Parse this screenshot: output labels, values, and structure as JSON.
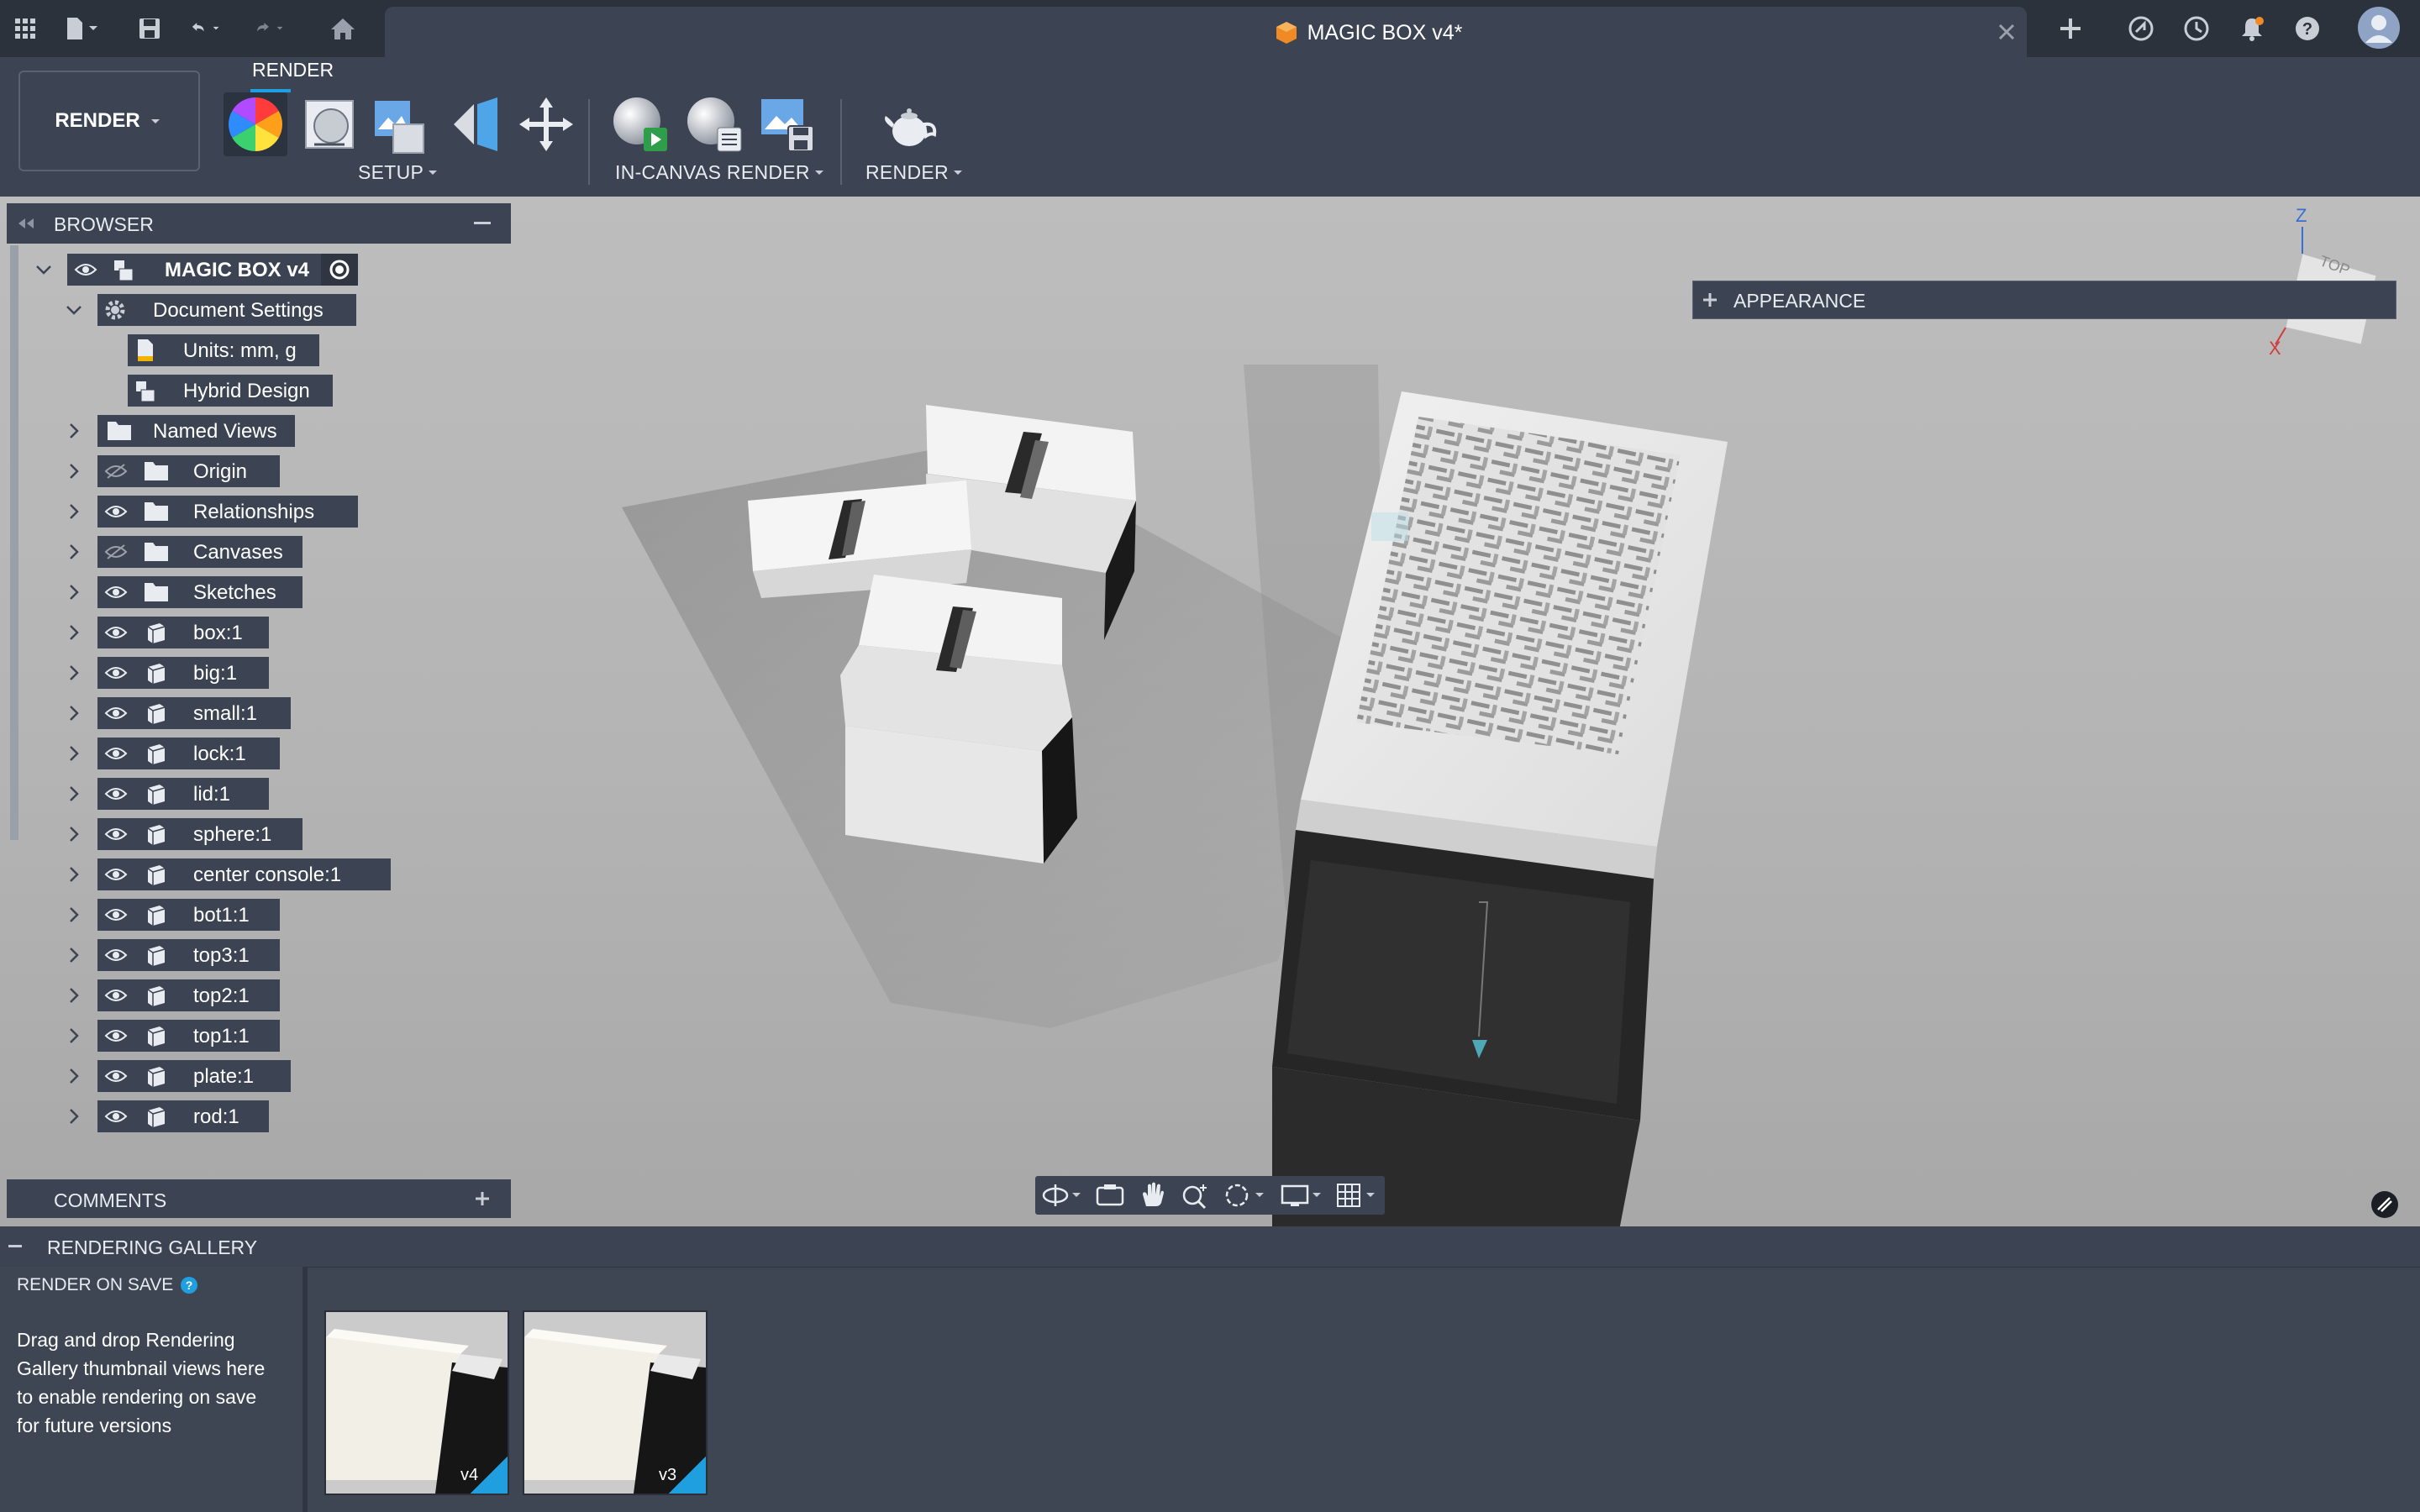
{
  "titlebar": {
    "document_title": "MAGIC BOX v4*",
    "icons": [
      "apps-grid-icon",
      "file-icon",
      "save-icon",
      "undo-icon",
      "redo-icon",
      "home-icon",
      "close-tab-icon",
      "new-tab-icon",
      "extensions-icon",
      "job-status-icon",
      "notifications-icon",
      "help-icon",
      "user-avatar"
    ]
  },
  "toolbar": {
    "workspace_label": "RENDER",
    "tab_label": "RENDER",
    "groups": {
      "setup": "SETUP",
      "in_canvas_render": "IN-CANVAS RENDER",
      "render": "RENDER"
    }
  },
  "browser": {
    "title": "BROWSER",
    "root": "MAGIC BOX v4",
    "document_settings": "Document Settings",
    "units": "Units: mm, g",
    "design_type": "Hybrid Design",
    "items": [
      {
        "label": "Named Views",
        "type": "folder",
        "visible": null
      },
      {
        "label": "Origin",
        "type": "folder",
        "visible": false
      },
      {
        "label": "Relationships",
        "type": "folder",
        "visible": true
      },
      {
        "label": "Canvases",
        "type": "folder",
        "visible": false
      },
      {
        "label": "Sketches",
        "type": "folder",
        "visible": true
      },
      {
        "label": "box:1",
        "type": "component",
        "visible": true
      },
      {
        "label": "big:1",
        "type": "component",
        "visible": true
      },
      {
        "label": "small:1",
        "type": "component",
        "visible": true
      },
      {
        "label": "lock:1",
        "type": "component",
        "visible": true
      },
      {
        "label": "lid:1",
        "type": "component",
        "visible": true
      },
      {
        "label": "sphere:1",
        "type": "component",
        "visible": true
      },
      {
        "label": "center console:1",
        "type": "component",
        "visible": true
      },
      {
        "label": "bot1:1",
        "type": "component",
        "visible": true
      },
      {
        "label": "top3:1",
        "type": "component",
        "visible": true
      },
      {
        "label": "top2:1",
        "type": "component",
        "visible": true
      },
      {
        "label": "top1:1",
        "type": "component",
        "visible": true
      },
      {
        "label": "plate:1",
        "type": "component",
        "visible": true
      },
      {
        "label": "rod:1",
        "type": "component",
        "visible": true
      }
    ]
  },
  "appearance_panel": {
    "label": "APPEARANCE"
  },
  "viewcube": {
    "z": "Z",
    "x": "X",
    "face": "TOP"
  },
  "comments": {
    "label": "COMMENTS"
  },
  "gallery": {
    "title": "RENDERING GALLERY",
    "render_on_save": "RENDER ON SAVE",
    "hint": "Drag and drop Rendering Gallery thumbnail views here to enable rendering on save for future versions",
    "thumbnails": [
      {
        "version": "v4"
      },
      {
        "version": "v3"
      }
    ]
  },
  "colors": {
    "accent_blue": "#1f9ee0",
    "panel": "#3c4453",
    "viewport": "#b4b4b4",
    "doc_icon_orange": "#f08a24"
  }
}
